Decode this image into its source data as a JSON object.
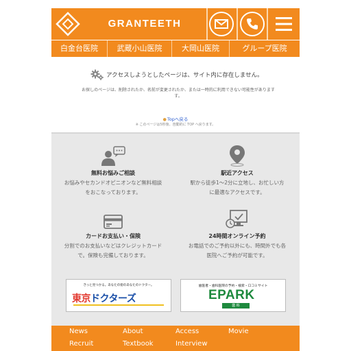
{
  "header": {
    "brand": "GRANTEETH",
    "mail_icon": "mail-icon",
    "phone_icon": "phone-icon",
    "menu_icon": "hamburger-menu-icon"
  },
  "clinics": [
    {
      "label": "白金台医院"
    },
    {
      "label": "武蔵小山医院"
    },
    {
      "label": "大岡山医院"
    },
    {
      "label": "グループ医院"
    }
  ],
  "not_found": {
    "title": "アクセスしようとしたページは、サイト内に存在しません。",
    "desc_line1": "お探しのページは、削除されたか、名前が変更されたか、または一時的に利用できない可能性があります",
    "desc_line2": "す。",
    "back_link": "Topへ戻る",
    "note": "※ このページは5秒後、自動的に TOP へ戻ります。"
  },
  "features": [
    {
      "icon": "consultation-icon",
      "title": "無料お悩みご相談",
      "line1": "お悩みやセカンドオピニオンなど無料相談",
      "line2": "をおこなっております。"
    },
    {
      "icon": "map-pin-icon",
      "title": "駅近アクセス",
      "line1": "駅から徒歩1〜2分に立地し、お忙しい方",
      "line2": "に最適なアクセスです。"
    },
    {
      "icon": "credit-card-icon",
      "title": "カードお支払い・保険",
      "line1": "分割でのお支払いなどはクレジットカード",
      "line2": "で。保険も完備しております。"
    },
    {
      "icon": "online-reservation-icon",
      "title": "24時間オンライン予約",
      "line1": "お電話でのご予約以外にも、時間外でも各",
      "line2": "医院へご予約が可能です。"
    }
  ],
  "banners": {
    "tokyo_doctors": {
      "caption": "きっと見つかる。あなたの街のあなたのドクター。",
      "logo_a": "東京",
      "logo_b": "ドクターズ"
    },
    "epark": {
      "caption": "歯医者・歯科医院の予約・検索・口コミサイト",
      "logo": "EPARK",
      "sub": "歯 科"
    }
  },
  "footer": {
    "items": [
      {
        "label": "News"
      },
      {
        "label": "About"
      },
      {
        "label": "Access"
      },
      {
        "label": "Movie"
      },
      {
        "label": "Recruit"
      },
      {
        "label": "Textbook"
      },
      {
        "label": "Interview"
      }
    ]
  },
  "colors": {
    "accent": "#f28a1e",
    "link": "#3060d0",
    "feature_bg": "#e8e8e8"
  }
}
